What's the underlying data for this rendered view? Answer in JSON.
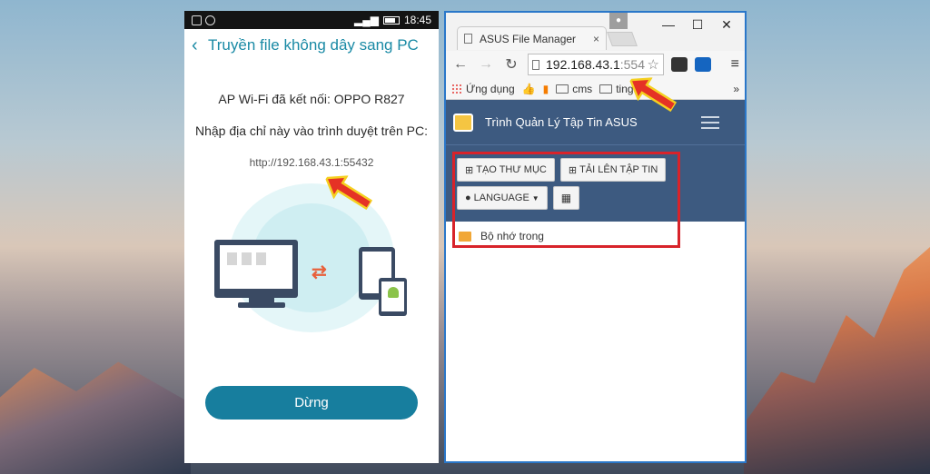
{
  "phone": {
    "status_time": "18:45",
    "title": "Truyền file không dây sang PC",
    "connected_label": "AP Wi-Fi đã kết nối: OPPO R827",
    "instruction": "Nhập địa chỉ này vào trình duyệt trên PC:",
    "url": "http://192.168.43.1:55432",
    "stop_button": "Dừng"
  },
  "browser": {
    "tab_title": "ASUS File Manager",
    "tab_close": "×",
    "window_controls": [
      "—",
      "☐",
      "✕"
    ],
    "address_host": "192.168.43.1",
    "address_port": ":554",
    "bookmarks": [
      {
        "label": "Ứng dụng",
        "icon": "apps-icon"
      },
      {
        "label": "cms",
        "icon": "folder-icon"
      },
      {
        "label": "ting",
        "icon": "folder-icon"
      }
    ],
    "app_title": "Trình Quản Lý Tập Tin ASUS",
    "buttons": {
      "new_folder": "TẠO THƯ MỤC",
      "upload": "TẢI LÊN TẬP TIN",
      "language": "LANGUAGE"
    },
    "files": [
      {
        "name": "Bộ nhớ trong"
      }
    ]
  },
  "colors": {
    "accent": "#1a8aa5",
    "stop_button": "#177e9e",
    "app_header": "#3d5a80",
    "highlight": "#d8232a",
    "browser_border": "#2a77c9"
  }
}
